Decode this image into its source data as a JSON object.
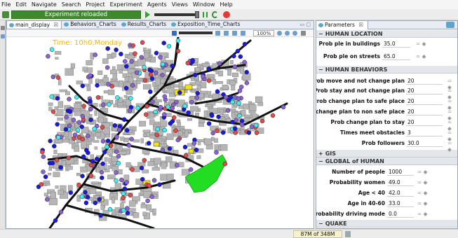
{
  "menu": [
    "File",
    "Edit",
    "Navigate",
    "Search",
    "Project",
    "Experiment",
    "Agents",
    "Views",
    "Window",
    "Help"
  ],
  "toolbar": {
    "status_label": "Experiment reloaded"
  },
  "editor": {
    "tabs": [
      {
        "label": "main_display",
        "close": "☒",
        "active": true
      },
      {
        "label": "Behaviors_Charts",
        "close": "",
        "active": false
      },
      {
        "label": "Results_Charts",
        "close": "",
        "active": false
      },
      {
        "label": "Exposition_Time_Charts",
        "close": "",
        "active": false
      }
    ],
    "win_controls": "▭ ▢",
    "zoom": "100%"
  },
  "map": {
    "time_label": "Time: 10h0,Monday",
    "colors": {
      "road": "#111111",
      "building_fill": "#b5b5b5",
      "safe_zone": "#22dd22",
      "buildings_highlight": "#f0e21a",
      "agent_blue": "#1a1adf",
      "agent_purple": "#8b63d1",
      "agent_red": "#e24a4a",
      "agent_cyan": "#3ff0f0"
    }
  },
  "params_panel": {
    "tab_label": "Parameters",
    "tab_close": "☒",
    "sections": [
      {
        "key": "human_location",
        "title": "HUMAN LOCATION",
        "toggle": "−"
      },
      {
        "key": "human_behaviors",
        "title": "HUMAN BEHAVIORS",
        "toggle": "−"
      },
      {
        "key": "gis",
        "title": "GIS",
        "toggle": "+"
      },
      {
        "key": "global_human",
        "title": "GLOBAL of HUMAN",
        "toggle": "−"
      },
      {
        "key": "quake",
        "title": "QUAKE",
        "toggle": "−"
      }
    ],
    "rows": [
      {
        "label": "Prob ple in buildings",
        "value": "35.0",
        "ctl": "= ◆"
      },
      {
        "label": "Prob ple on streets",
        "value": "65.0",
        "ctl": "= ◆"
      },
      {
        "label": "Prob move and not change plan",
        "value": "20",
        "ctl": "= ◆"
      },
      {
        "label": "Prob stay and not change plan",
        "value": "20",
        "ctl": "= ◆"
      },
      {
        "label": "Prob change plan to safe place",
        "value": "20",
        "ctl": "= ◆"
      },
      {
        "label": "Prob change plan to non safe place",
        "value": "20",
        "ctl": "= ◆"
      },
      {
        "label": "Prob change plan to stay",
        "value": "20",
        "ctl": "= ◆"
      },
      {
        "label": "Times meet obstacles",
        "value": "3",
        "ctl": "= ◆"
      },
      {
        "label": "Prob followers",
        "value": "30.0",
        "ctl": "= ◆"
      },
      {
        "label": "Number of people",
        "value": "1000",
        "ctl": "= ◆"
      },
      {
        "label": "Probability women",
        "value": "49.0",
        "ctl": "= ◆"
      },
      {
        "label": "Age < 40",
        "value": "42.0",
        "ctl": "= ◆"
      },
      {
        "label": "Age in 40-60",
        "value": "33.0",
        "ctl": "= ◆"
      },
      {
        "label": "Probability driving mode",
        "value": "0.0",
        "ctl": "= ◆"
      }
    ]
  },
  "status": {
    "memory": "87M of 348M"
  }
}
